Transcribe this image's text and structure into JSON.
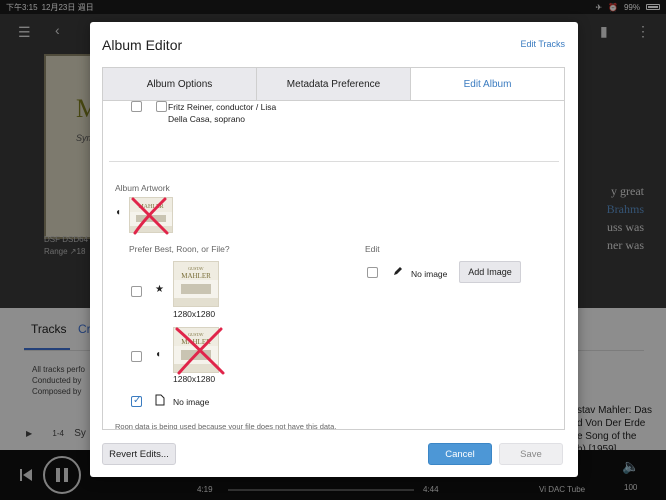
{
  "statusbar": {
    "time": "下午3:15",
    "date": "12月23日 週日",
    "battery": "99%"
  },
  "background": {
    "cover_big_letter": "M",
    "cover_sub": "Sym",
    "format": "DSF DSD64",
    "range": "Range ↗18",
    "right_text": [
      "y great",
      "Brahms",
      "uss was",
      "ner was"
    ],
    "tab_tracks": "Tracks",
    "tab_c": "Cr",
    "credits": [
      "All tracks perfo",
      "Conducted by",
      "Composed by"
    ],
    "track_num": "1-4",
    "track_title": "Sy",
    "right_lower": [
      "stav Mahler: Das",
      "d Von Der Erde",
      "e Song of the",
      "h) [1959]"
    ],
    "time_elapsed": "4:19",
    "time_total": "4:44",
    "device": "Vi DAC Tube",
    "volume": "100"
  },
  "modal": {
    "title": "Album Editor",
    "edit_tracks_link": "Edit Tracks",
    "tabs": [
      {
        "label": "Album Options",
        "active": false
      },
      {
        "label": "Metadata Preference",
        "active": false
      },
      {
        "label": "Edit Album",
        "active": true
      }
    ],
    "credit_line1": "Fritz Reiner, conductor / Lisa",
    "credit_line2": "Della Casa, soprano",
    "section_label": "Album Artwork",
    "prefer_label": "Prefer Best, Roon, or File?",
    "edit_label": "Edit",
    "options": [
      {
        "source": "best",
        "resolution": "1280x1280",
        "checked": false,
        "icon": "star-icon"
      },
      {
        "source": "file",
        "resolution": "1280x1280",
        "checked": false,
        "icon": "speaker-icon"
      },
      {
        "source": "none",
        "label": "No image",
        "checked": true,
        "icon": "file-icon"
      }
    ],
    "edit_no_image": "No image",
    "add_image_button": "Add Image",
    "note": "Roon data is being used because your file does not have this data.",
    "revert_button": "Revert Edits...",
    "cancel_button": "Cancel",
    "save_button": "Save",
    "thumb_text": "MAHLER",
    "thumb_text_small": "GUSTAV"
  },
  "colors": {
    "accent": "#3a7bc0",
    "cancel": "#4d97d6",
    "xmark": "#e0254a"
  }
}
